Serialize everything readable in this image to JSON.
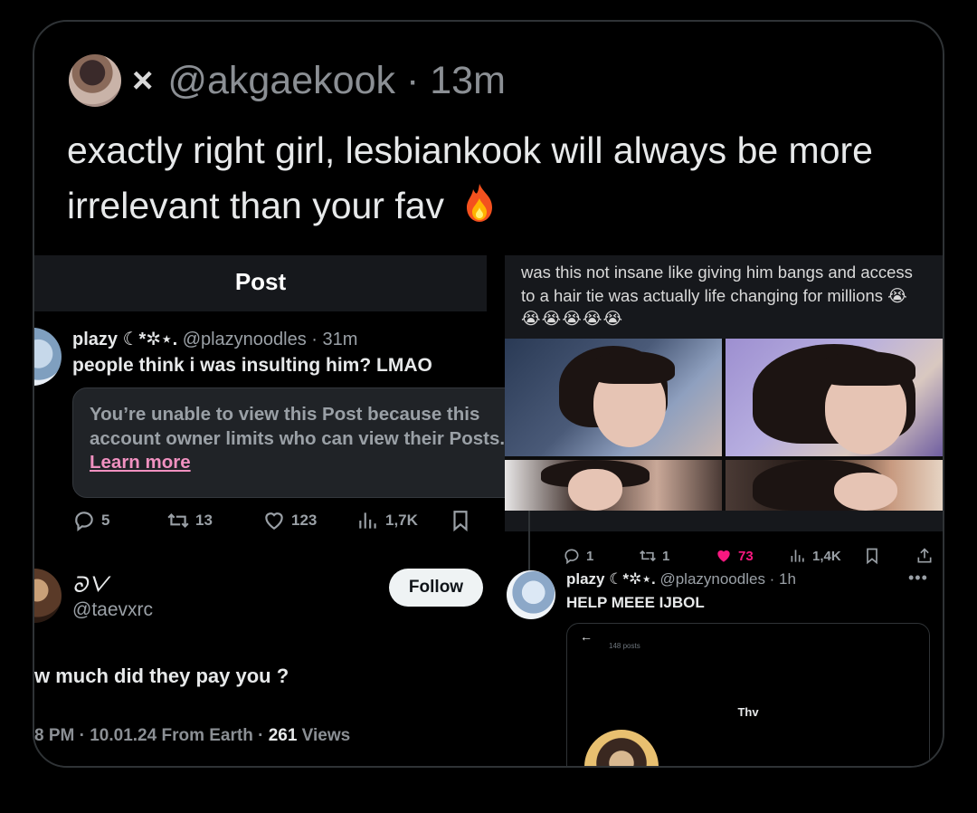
{
  "outer_post": {
    "separator": "×",
    "handle": "@akgaekook",
    "time": "· 13m",
    "text": "exactly right girl, lesbiankook will always be more irrelevant than your fav",
    "emoji_icon": "fire-icon"
  },
  "left_screenshot": {
    "header_title": "Post",
    "reply": {
      "display_name": "plazy ☾*✲⋆.",
      "handle_time": "@plazynoodles · 31m",
      "text": "people think i was insulting him? LMAO"
    },
    "unavailable_notice": {
      "text": "You’re unable to view this Post because this account owner limits who can view their Posts.",
      "link": "Learn more"
    },
    "actions": {
      "replies": "5",
      "reposts": "13",
      "likes": "123",
      "views": "1,7K"
    },
    "main_post": {
      "display_name": "ᘐᐯ",
      "handle": "@taevxrc",
      "follow_label": "Follow",
      "text": "w much did they pay you ?",
      "meta_prefix": "8 PM · 10.01.24 From Earth · ",
      "views_count": "261",
      "views_label": " Views"
    }
  },
  "right_screenshot": {
    "quoted_text": "was this not insane like giving him bangs and access to a hair tie was actually life changing for millions",
    "quoted_emojis": "😭😭😭😭😭😭",
    "actions": {
      "replies": "1",
      "reposts": "1",
      "likes": "73",
      "views": "1,4K"
    },
    "reply": {
      "display_name": "plazy ☾*✲⋆.",
      "handle_time": "@plazynoodles · 1h",
      "more": "•••",
      "text": "HELP MEEE IJBOL",
      "embed": {
        "back": "←",
        "posts_count": "148 posts",
        "name": "Thv"
      }
    }
  },
  "colors": {
    "background": "#000000",
    "text_primary": "#e7e9ea",
    "text_muted": "#8b8f94",
    "like_pink": "#f91880",
    "learn_more_pink": "#f091c0"
  }
}
